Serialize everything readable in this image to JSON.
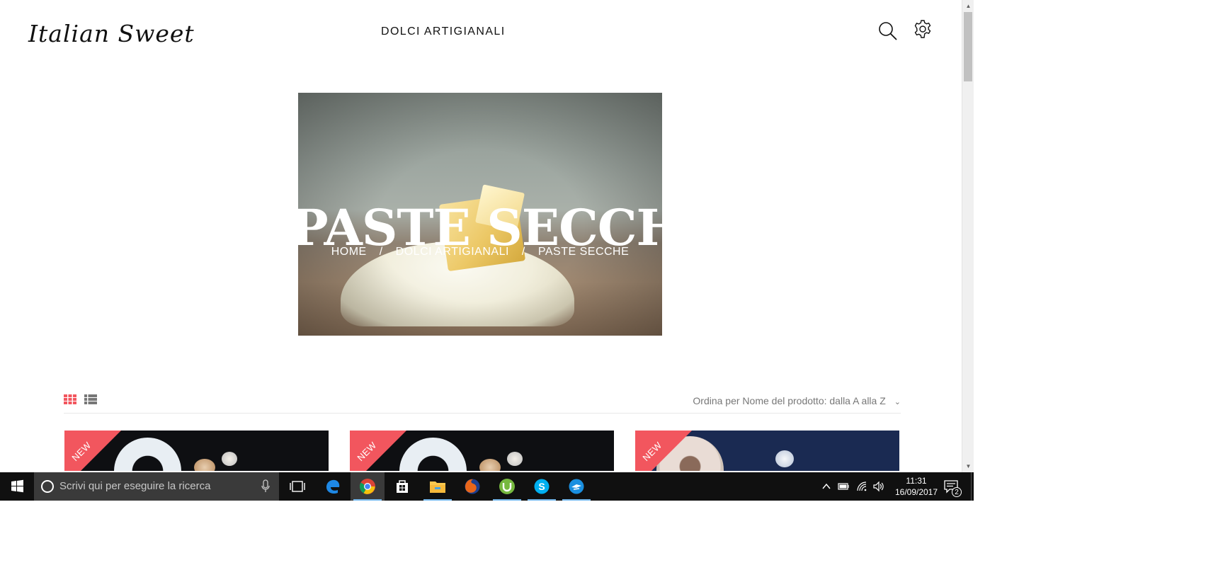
{
  "site": {
    "logo": "Italian Sweet",
    "nav_label": "DOLCI ARTIGIANALI"
  },
  "icons": {
    "search": "search-icon",
    "settings": "gear-icon"
  },
  "hero": {
    "title": "PASTE SECCHE",
    "breadcrumb": [
      "HOME",
      "DOLCI ARTIGIANALI",
      "PASTE SECCHE"
    ],
    "separator": "/"
  },
  "toolbar": {
    "sort_label": "Ordina per Nome del prodotto: dalla A alla Z",
    "active_view": "grid",
    "accent_color": "#f2565e"
  },
  "products": [
    {
      "badge": "NEW"
    },
    {
      "badge": "NEW"
    },
    {
      "badge": "NEW"
    }
  ],
  "taskbar": {
    "search_placeholder": "Scrivi qui per eseguire la ricerca",
    "apps": [
      "task-view",
      "edge",
      "chrome",
      "store",
      "file-explorer",
      "firefox",
      "utorrent",
      "skype",
      "app"
    ],
    "time": "11:31",
    "date": "16/09/2017",
    "notifications": "2"
  }
}
